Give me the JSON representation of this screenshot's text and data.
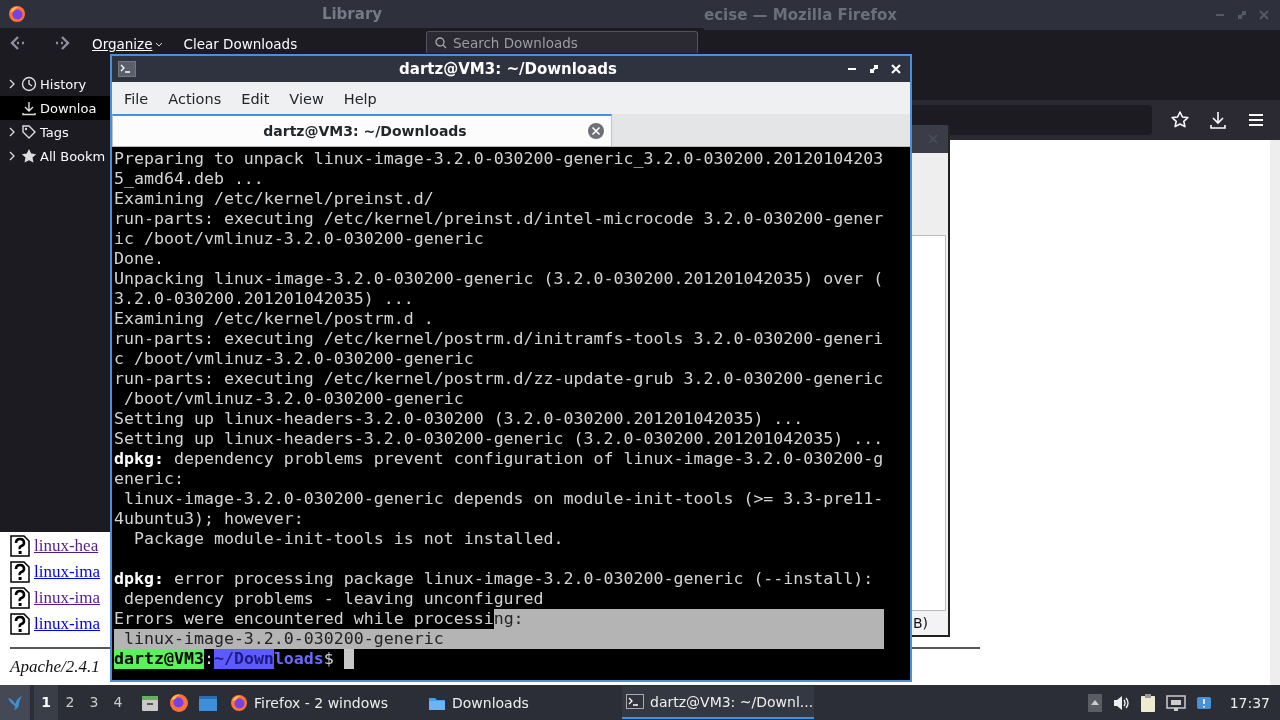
{
  "firefox_window": {
    "title": "ecise — Mozilla Firefox",
    "page": {
      "links": [
        {
          "text": "linux-hea",
          "visited": true
        },
        {
          "text": "linux-ima",
          "visited": false
        },
        {
          "text": "linux-ima",
          "visited": true
        },
        {
          "text": "linux-ima",
          "visited": false
        }
      ],
      "footer": "Apache/2.4.1"
    },
    "dialog": {
      "status": "B)"
    }
  },
  "library_window": {
    "title": "Library",
    "toolbar": {
      "organize": "Organize",
      "clear": "Clear Downloads",
      "search": {
        "placeholder": "Search Downloads"
      }
    },
    "sidebar": {
      "items": [
        {
          "label": "History",
          "expanded": false,
          "selected": false
        },
        {
          "label": "Downloa",
          "selected": true
        },
        {
          "label": "Tags",
          "expanded": false,
          "selected": false
        },
        {
          "label": "All Bookm",
          "expanded": false,
          "selected": false
        }
      ]
    }
  },
  "terminal_window": {
    "title": "dartz@VM3: ~/Downloads",
    "menu": [
      "File",
      "Actions",
      "Edit",
      "View",
      "Help"
    ],
    "tabs": [
      {
        "label": "dartz@VM3: ~/Downloads",
        "selected": true
      }
    ],
    "lines": [
      {
        "kind": "text",
        "text": "Preparing to unpack linux-image-3.2.0-030200-generic_3.2.0-030200.20120104203"
      },
      {
        "kind": "text",
        "text": "5_amd64.deb ..."
      },
      {
        "kind": "text",
        "text": "Examining /etc/kernel/preinst.d/"
      },
      {
        "kind": "text",
        "text": "run-parts: executing /etc/kernel/preinst.d/intel-microcode 3.2.0-030200-gener"
      },
      {
        "kind": "text",
        "text": "ic /boot/vmlinuz-3.2.0-030200-generic"
      },
      {
        "kind": "text",
        "text": "Done."
      },
      {
        "kind": "text",
        "text": "Unpacking linux-image-3.2.0-030200-generic (3.2.0-030200.201201042035) over ("
      },
      {
        "kind": "text",
        "text": "3.2.0-030200.201201042035) ..."
      },
      {
        "kind": "text",
        "text": "Examining /etc/kernel/postrm.d ."
      },
      {
        "kind": "text",
        "text": "run-parts: executing /etc/kernel/postrm.d/initramfs-tools 3.2.0-030200-generi"
      },
      {
        "kind": "text",
        "text": "c /boot/vmlinuz-3.2.0-030200-generic"
      },
      {
        "kind": "text",
        "text": "run-parts: executing /etc/kernel/postrm.d/zz-update-grub 3.2.0-030200-generic"
      },
      {
        "kind": "text",
        "text": " /boot/vmlinuz-3.2.0-030200-generic"
      },
      {
        "kind": "text",
        "text": "Setting up linux-headers-3.2.0-030200 (3.2.0-030200.201201042035) ..."
      },
      {
        "kind": "text",
        "text": "Setting up linux-headers-3.2.0-030200-generic (3.2.0-030200.201201042035) ..."
      },
      {
        "kind": "text",
        "text": "**dpkg:** dependency problems prevent configuration of linux-image-3.2.0-030200-g"
      },
      {
        "kind": "text",
        "text": "eneric:"
      },
      {
        "kind": "text",
        "text": " linux-image-3.2.0-030200-generic depends on module-init-tools (>= 3.3-pre11-"
      },
      {
        "kind": "text",
        "text": "4ubuntu3); however:"
      },
      {
        "kind": "text",
        "text": "  Package module-init-tools is not installed."
      },
      {
        "kind": "blank"
      },
      {
        "kind": "text",
        "text": "**dpkg:** error processing package linux-image-3.2.0-030200-generic (--install):"
      },
      {
        "kind": "text",
        "text": " dependency problems - leaving unconfigured"
      },
      {
        "kind": "segments",
        "selection_to_edge": true,
        "segments": [
          {
            "text": "Errors were encountered while processi",
            "kind": "text",
            "selected": false
          },
          {
            "text": "ng:",
            "kind": "text",
            "selected": true
          }
        ]
      },
      {
        "kind": "segments",
        "selection_to_edge": true,
        "segments": [
          {
            "text": " linux-image-3.2.0-030200-generic",
            "kind": "text",
            "selected": true
          }
        ]
      },
      {
        "kind": "segments",
        "cursor": true,
        "segments": [
          {
            "text": "dartz@VM3",
            "kind": "user",
            "selected": false
          },
          {
            "text": ":",
            "kind": "text",
            "selected": false
          },
          {
            "text": "~/Down",
            "kind": "path",
            "selected": true
          },
          {
            "text": "loads",
            "kind": "path",
            "selected": false
          },
          {
            "text": "$",
            "kind": "text",
            "selected": false
          }
        ]
      }
    ]
  },
  "taskbar": {
    "workspaces": [
      {
        "label": "1",
        "selected": true
      },
      {
        "label": "2",
        "selected": false
      },
      {
        "label": "3",
        "selected": false
      },
      {
        "label": "4",
        "selected": false
      }
    ],
    "tasks": [
      {
        "label": "Firefox - 2 windows",
        "selected": false
      },
      {
        "label": "Downloads",
        "selected": false
      },
      {
        "label": "dartz@VM3: ~/Downl...",
        "selected": true
      }
    ],
    "clock": "17:37"
  }
}
